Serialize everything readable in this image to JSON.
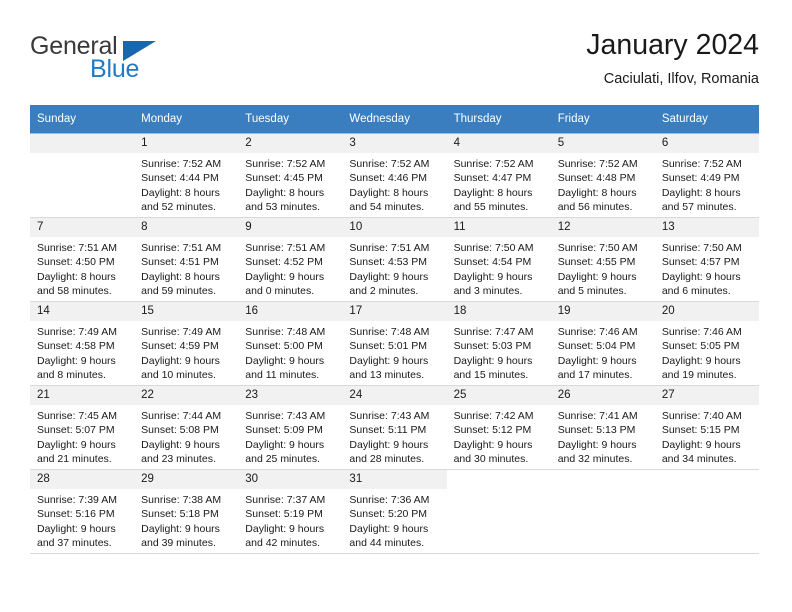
{
  "brand": {
    "word1": "General",
    "word2": "Blue",
    "triangle_color": "#1667ae",
    "blue_color": "#1f7cc4"
  },
  "header": {
    "title": "January 2024",
    "location": "Caciulati, Ilfov, Romania"
  },
  "theme": {
    "header_row_bg": "#3a7ebf",
    "daynum_bg": "#f1f1f1",
    "grid_line": "#b8b8b8"
  },
  "weekday_headers": [
    "Sunday",
    "Monday",
    "Tuesday",
    "Wednesday",
    "Thursday",
    "Friday",
    "Saturday"
  ],
  "weeks": [
    [
      {
        "day": "",
        "sunrise": "",
        "sunset": "",
        "daylight1": "",
        "daylight2": "",
        "empty": true
      },
      {
        "day": "1",
        "sunrise": "Sunrise: 7:52 AM",
        "sunset": "Sunset: 4:44 PM",
        "daylight1": "Daylight: 8 hours",
        "daylight2": "and 52 minutes."
      },
      {
        "day": "2",
        "sunrise": "Sunrise: 7:52 AM",
        "sunset": "Sunset: 4:45 PM",
        "daylight1": "Daylight: 8 hours",
        "daylight2": "and 53 minutes."
      },
      {
        "day": "3",
        "sunrise": "Sunrise: 7:52 AM",
        "sunset": "Sunset: 4:46 PM",
        "daylight1": "Daylight: 8 hours",
        "daylight2": "and 54 minutes."
      },
      {
        "day": "4",
        "sunrise": "Sunrise: 7:52 AM",
        "sunset": "Sunset: 4:47 PM",
        "daylight1": "Daylight: 8 hours",
        "daylight2": "and 55 minutes."
      },
      {
        "day": "5",
        "sunrise": "Sunrise: 7:52 AM",
        "sunset": "Sunset: 4:48 PM",
        "daylight1": "Daylight: 8 hours",
        "daylight2": "and 56 minutes."
      },
      {
        "day": "6",
        "sunrise": "Sunrise: 7:52 AM",
        "sunset": "Sunset: 4:49 PM",
        "daylight1": "Daylight: 8 hours",
        "daylight2": "and 57 minutes."
      }
    ],
    [
      {
        "day": "7",
        "sunrise": "Sunrise: 7:51 AM",
        "sunset": "Sunset: 4:50 PM",
        "daylight1": "Daylight: 8 hours",
        "daylight2": "and 58 minutes."
      },
      {
        "day": "8",
        "sunrise": "Sunrise: 7:51 AM",
        "sunset": "Sunset: 4:51 PM",
        "daylight1": "Daylight: 8 hours",
        "daylight2": "and 59 minutes."
      },
      {
        "day": "9",
        "sunrise": "Sunrise: 7:51 AM",
        "sunset": "Sunset: 4:52 PM",
        "daylight1": "Daylight: 9 hours",
        "daylight2": "and 0 minutes."
      },
      {
        "day": "10",
        "sunrise": "Sunrise: 7:51 AM",
        "sunset": "Sunset: 4:53 PM",
        "daylight1": "Daylight: 9 hours",
        "daylight2": "and 2 minutes."
      },
      {
        "day": "11",
        "sunrise": "Sunrise: 7:50 AM",
        "sunset": "Sunset: 4:54 PM",
        "daylight1": "Daylight: 9 hours",
        "daylight2": "and 3 minutes."
      },
      {
        "day": "12",
        "sunrise": "Sunrise: 7:50 AM",
        "sunset": "Sunset: 4:55 PM",
        "daylight1": "Daylight: 9 hours",
        "daylight2": "and 5 minutes."
      },
      {
        "day": "13",
        "sunrise": "Sunrise: 7:50 AM",
        "sunset": "Sunset: 4:57 PM",
        "daylight1": "Daylight: 9 hours",
        "daylight2": "and 6 minutes."
      }
    ],
    [
      {
        "day": "14",
        "sunrise": "Sunrise: 7:49 AM",
        "sunset": "Sunset: 4:58 PM",
        "daylight1": "Daylight: 9 hours",
        "daylight2": "and 8 minutes."
      },
      {
        "day": "15",
        "sunrise": "Sunrise: 7:49 AM",
        "sunset": "Sunset: 4:59 PM",
        "daylight1": "Daylight: 9 hours",
        "daylight2": "and 10 minutes."
      },
      {
        "day": "16",
        "sunrise": "Sunrise: 7:48 AM",
        "sunset": "Sunset: 5:00 PM",
        "daylight1": "Daylight: 9 hours",
        "daylight2": "and 11 minutes."
      },
      {
        "day": "17",
        "sunrise": "Sunrise: 7:48 AM",
        "sunset": "Sunset: 5:01 PM",
        "daylight1": "Daylight: 9 hours",
        "daylight2": "and 13 minutes."
      },
      {
        "day": "18",
        "sunrise": "Sunrise: 7:47 AM",
        "sunset": "Sunset: 5:03 PM",
        "daylight1": "Daylight: 9 hours",
        "daylight2": "and 15 minutes."
      },
      {
        "day": "19",
        "sunrise": "Sunrise: 7:46 AM",
        "sunset": "Sunset: 5:04 PM",
        "daylight1": "Daylight: 9 hours",
        "daylight2": "and 17 minutes."
      },
      {
        "day": "20",
        "sunrise": "Sunrise: 7:46 AM",
        "sunset": "Sunset: 5:05 PM",
        "daylight1": "Daylight: 9 hours",
        "daylight2": "and 19 minutes."
      }
    ],
    [
      {
        "day": "21",
        "sunrise": "Sunrise: 7:45 AM",
        "sunset": "Sunset: 5:07 PM",
        "daylight1": "Daylight: 9 hours",
        "daylight2": "and 21 minutes."
      },
      {
        "day": "22",
        "sunrise": "Sunrise: 7:44 AM",
        "sunset": "Sunset: 5:08 PM",
        "daylight1": "Daylight: 9 hours",
        "daylight2": "and 23 minutes."
      },
      {
        "day": "23",
        "sunrise": "Sunrise: 7:43 AM",
        "sunset": "Sunset: 5:09 PM",
        "daylight1": "Daylight: 9 hours",
        "daylight2": "and 25 minutes."
      },
      {
        "day": "24",
        "sunrise": "Sunrise: 7:43 AM",
        "sunset": "Sunset: 5:11 PM",
        "daylight1": "Daylight: 9 hours",
        "daylight2": "and 28 minutes."
      },
      {
        "day": "25",
        "sunrise": "Sunrise: 7:42 AM",
        "sunset": "Sunset: 5:12 PM",
        "daylight1": "Daylight: 9 hours",
        "daylight2": "and 30 minutes."
      },
      {
        "day": "26",
        "sunrise": "Sunrise: 7:41 AM",
        "sunset": "Sunset: 5:13 PM",
        "daylight1": "Daylight: 9 hours",
        "daylight2": "and 32 minutes."
      },
      {
        "day": "27",
        "sunrise": "Sunrise: 7:40 AM",
        "sunset": "Sunset: 5:15 PM",
        "daylight1": "Daylight: 9 hours",
        "daylight2": "and 34 minutes."
      }
    ],
    [
      {
        "day": "28",
        "sunrise": "Sunrise: 7:39 AM",
        "sunset": "Sunset: 5:16 PM",
        "daylight1": "Daylight: 9 hours",
        "daylight2": "and 37 minutes."
      },
      {
        "day": "29",
        "sunrise": "Sunrise: 7:38 AM",
        "sunset": "Sunset: 5:18 PM",
        "daylight1": "Daylight: 9 hours",
        "daylight2": "and 39 minutes."
      },
      {
        "day": "30",
        "sunrise": "Sunrise: 7:37 AM",
        "sunset": "Sunset: 5:19 PM",
        "daylight1": "Daylight: 9 hours",
        "daylight2": "and 42 minutes."
      },
      {
        "day": "31",
        "sunrise": "Sunrise: 7:36 AM",
        "sunset": "Sunset: 5:20 PM",
        "daylight1": "Daylight: 9 hours",
        "daylight2": "and 44 minutes."
      },
      {
        "day": "",
        "sunrise": "",
        "sunset": "",
        "daylight1": "",
        "daylight2": "",
        "blank": true
      },
      {
        "day": "",
        "sunrise": "",
        "sunset": "",
        "daylight1": "",
        "daylight2": "",
        "blank": true
      },
      {
        "day": "",
        "sunrise": "",
        "sunset": "",
        "daylight1": "",
        "daylight2": "",
        "blank": true
      }
    ]
  ]
}
